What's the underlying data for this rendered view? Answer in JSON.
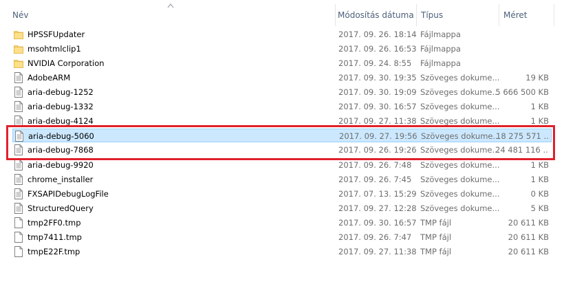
{
  "columns": {
    "name": "Név",
    "modified": "Módosítás dátuma",
    "type": "Típus",
    "size": "Méret"
  },
  "files": [
    {
      "name": "HPSSFUpdater",
      "modified": "2017. 09. 26. 18:14",
      "type": "Fájlmappa",
      "size": "",
      "icon": "folder-icon"
    },
    {
      "name": "msohtmlclip1",
      "modified": "2017. 09. 26. 16:53",
      "type": "Fájlmappa",
      "size": "",
      "icon": "folder-icon"
    },
    {
      "name": "NVIDIA Corporation",
      "modified": "2017. 09. 24. 8:55",
      "type": "Fájlmappa",
      "size": "",
      "icon": "folder-icon"
    },
    {
      "name": "AdobeARM",
      "modified": "2017. 09. 30. 19:35",
      "type": "Szöveges dokume...",
      "size": "19 KB",
      "icon": "text-file-icon"
    },
    {
      "name": "aria-debug-1252",
      "modified": "2017. 09. 30. 19:09",
      "type": "Szöveges dokume...",
      "size": "5 666 500 KB",
      "icon": "text-file-icon"
    },
    {
      "name": "aria-debug-1332",
      "modified": "2017. 09. 30. 16:57",
      "type": "Szöveges dokume...",
      "size": "1 KB",
      "icon": "text-file-icon"
    },
    {
      "name": "aria-debug-4124",
      "modified": "2017. 09. 27. 11:38",
      "type": "Szöveges dokume...",
      "size": "1 KB",
      "icon": "text-file-icon"
    },
    {
      "name": "aria-debug-5060",
      "modified": "2017. 09. 27. 19:56",
      "type": "Szöveges dokume...",
      "size": "18 275 571 ...",
      "icon": "text-file-icon",
      "selected": true
    },
    {
      "name": "aria-debug-7868",
      "modified": "2017. 09. 26. 19:26",
      "type": "Szöveges dokume...",
      "size": "24 481 116 ...",
      "icon": "text-file-icon"
    },
    {
      "name": "aria-debug-9920",
      "modified": "2017. 09. 26. 7:48",
      "type": "Szöveges dokume...",
      "size": "1 KB",
      "icon": "text-file-icon"
    },
    {
      "name": "chrome_installer",
      "modified": "2017. 09. 26. 7:45",
      "type": "Szöveges dokume...",
      "size": "1 KB",
      "icon": "text-file-icon"
    },
    {
      "name": "FXSAPIDebugLogFile",
      "modified": "2017. 07. 13. 15:29",
      "type": "Szöveges dokume...",
      "size": "0 KB",
      "icon": "text-file-icon"
    },
    {
      "name": "StructuredQuery",
      "modified": "2017. 09. 27. 12:28",
      "type": "Szöveges dokume...",
      "size": "5 KB",
      "icon": "text-file-icon"
    },
    {
      "name": "tmp2FF0.tmp",
      "modified": "2017. 09. 30. 16:57",
      "type": "TMP fájl",
      "size": "20 611 KB",
      "icon": "blank-file-icon"
    },
    {
      "name": "tmp7411.tmp",
      "modified": "2017. 09. 26. 7:47",
      "type": "TMP fájl",
      "size": "20 611 KB",
      "icon": "blank-file-icon"
    },
    {
      "name": "tmpE22F.tmp",
      "modified": "2017. 09. 27. 11:38",
      "type": "TMP fájl",
      "size": "20 611 KB",
      "icon": "blank-file-icon"
    }
  ],
  "colors": {
    "selection_bg": "#cce8ff",
    "selection_border": "#99d1ff",
    "annotation_red": "#e0202a",
    "header_text": "#4c607a"
  }
}
